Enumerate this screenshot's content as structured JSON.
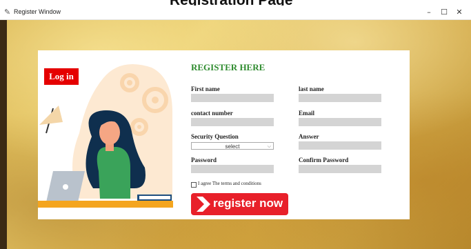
{
  "page_header": {
    "text": "Registration Page"
  },
  "window": {
    "title": "Register Window",
    "feather_icon": "feather-icon",
    "minimize": "–",
    "maximize": "☐",
    "close": "✕"
  },
  "login": {
    "label": "Log in"
  },
  "form": {
    "title": "REGISTER HERE",
    "first_name": {
      "label": "First name",
      "value": ""
    },
    "last_name": {
      "label": "last name",
      "value": ""
    },
    "contact_number": {
      "label": "contact number",
      "value": ""
    },
    "email": {
      "label": "Email",
      "value": ""
    },
    "security_question": {
      "label": "Security Question",
      "selected": "select"
    },
    "answer": {
      "label": "Answer",
      "value": ""
    },
    "password": {
      "label": "Password",
      "value": ""
    },
    "confirm_password": {
      "label": "Confirm Password",
      "value": ""
    },
    "terms": {
      "label": "I agree The terms and conditions",
      "checked": false
    },
    "register_button": {
      "label": "register now"
    }
  },
  "colors": {
    "accent_red": "#e8202a",
    "title_green": "#2e8b2e",
    "field_grey": "#d4d4d4"
  }
}
